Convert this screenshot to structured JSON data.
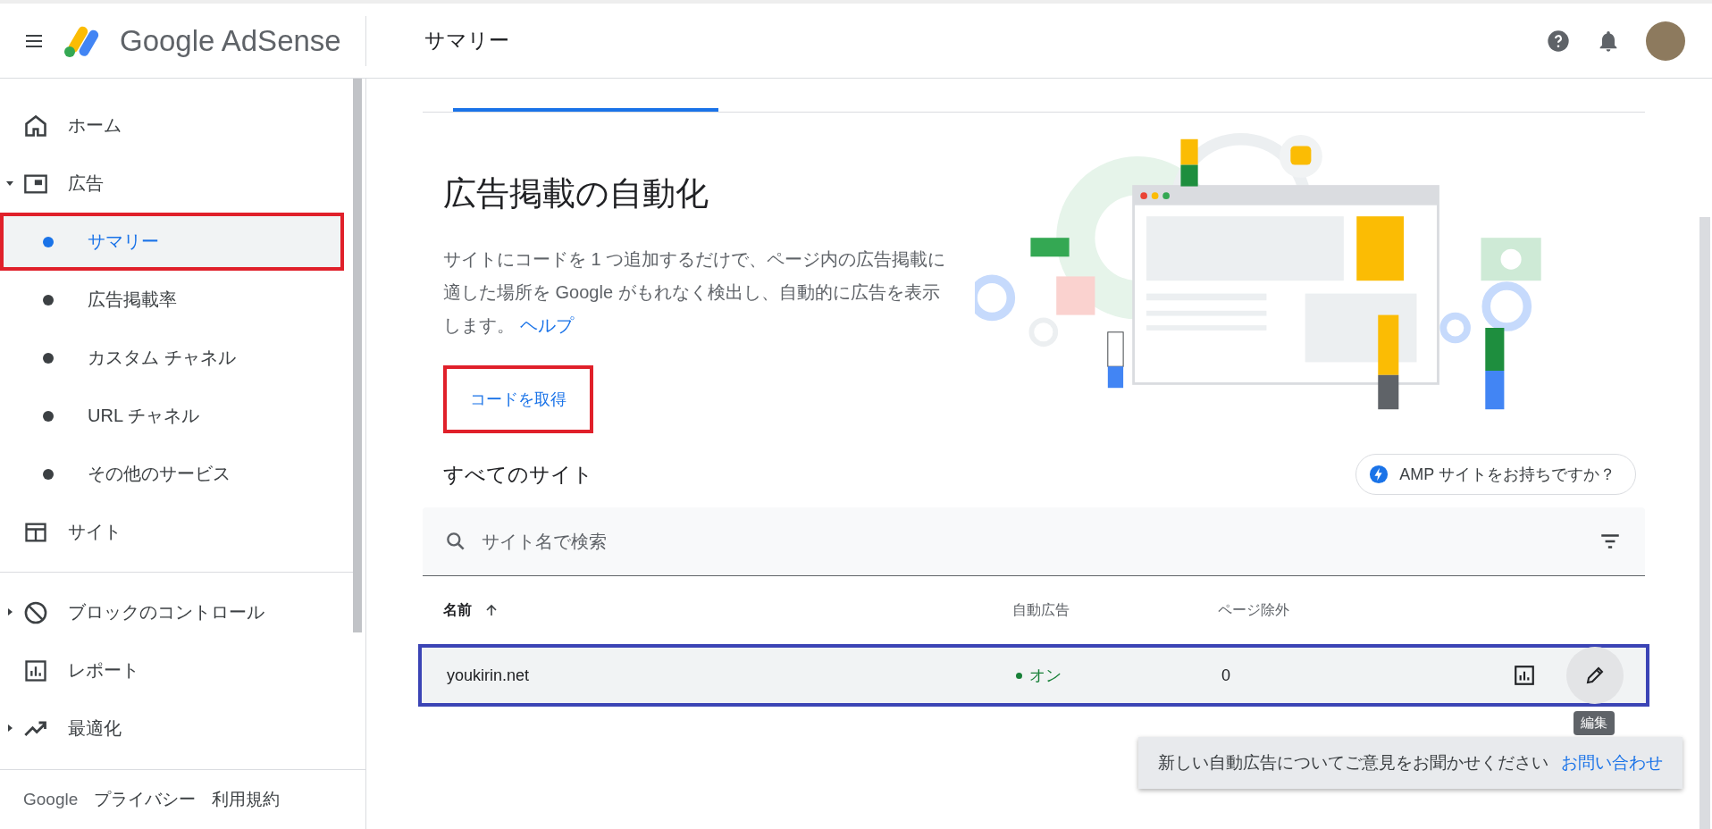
{
  "header": {
    "product": "Google AdSense",
    "page_title": "サマリー"
  },
  "sidebar": {
    "groups": [
      {
        "items": [
          {
            "label": "ホーム"
          },
          {
            "label": "広告",
            "expanded": true,
            "children": [
              {
                "label": "サマリー",
                "selected": true,
                "highlight": true
              },
              {
                "label": "広告掲載率",
                "selected": false,
                "highlight": false
              },
              {
                "label": "カスタム チャネル",
                "selected": false,
                "highlight": false
              },
              {
                "label": "URL チャネル",
                "selected": false,
                "highlight": false
              },
              {
                "label": "その他のサービス",
                "selected": false,
                "highlight": false
              }
            ]
          },
          {
            "label": "サイト"
          }
        ]
      },
      {
        "items": [
          {
            "label": "ブロックのコントロール",
            "expanded": false
          },
          {
            "label": "レポート"
          },
          {
            "label": "最適化",
            "expanded": false
          }
        ]
      }
    ],
    "footer": {
      "brand": "Google",
      "links": [
        "プライバシー",
        "利用規約"
      ]
    }
  },
  "tabs": [
    {
      "selected": true
    },
    {
      "selected": false
    }
  ],
  "hero": {
    "title": "広告掲載の自動化",
    "description": "サイトにコードを 1 つ追加するだけで、ページ内の広告掲載に適した場所を Google がもれなく検出し、自動的に広告を表示します。",
    "help_link": "ヘルプ",
    "button": {
      "label": "コードを取得",
      "highlight": true
    }
  },
  "sites": {
    "title": "すべてのサイト",
    "amp_chip": "AMP サイトをお持ちですか？",
    "search": {
      "placeholder": "サイト名で検索"
    },
    "columns": [
      {
        "label": "名前",
        "sorted": true
      },
      {
        "label": "自動広告",
        "sorted": false
      },
      {
        "label": "ページ除外",
        "sorted": false
      }
    ],
    "rows": [
      {
        "name": "youkirin.net",
        "auto_ads": {
          "label": "オン",
          "on": true
        },
        "excluded": "0",
        "highlight": true,
        "tooltip": "編集"
      }
    ]
  },
  "toast": {
    "message": "新しい自動広告についてご意見をお聞かせください",
    "link": "お問い合わせ"
  }
}
